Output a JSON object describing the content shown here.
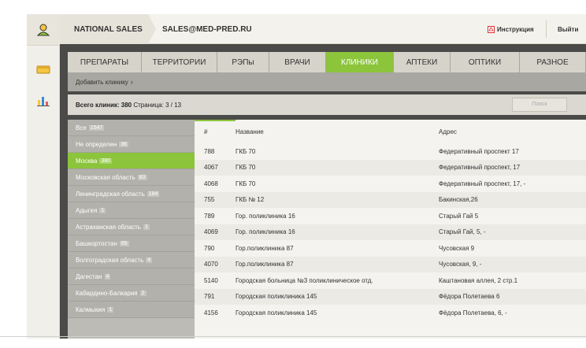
{
  "header": {
    "company": "NATIONAL SALES",
    "email": "SALES@MED-PRED.RU",
    "manual": "Инструкция",
    "logout": "Выйти"
  },
  "tabs": [
    {
      "label": "ПРЕПАРАТЫ",
      "active": false
    },
    {
      "label": "ТЕРРИТОРИИ",
      "active": false
    },
    {
      "label": "РЭПы",
      "active": false
    },
    {
      "label": "ВРАЧИ",
      "active": false
    },
    {
      "label": "КЛИНИКИ",
      "active": true
    },
    {
      "label": "АПТЕКИ",
      "active": false
    },
    {
      "label": "ОПТИКИ",
      "active": false
    },
    {
      "label": "РАЗНОЕ",
      "active": false
    }
  ],
  "add_clinic": "Добавить клинику",
  "info": {
    "total_label": "Всего клиник:",
    "total": "380",
    "page_label": "Страница:",
    "page": "3 / 13",
    "search_placeholder": "Поиск"
  },
  "regions": [
    {
      "name": "Все",
      "count": "1547",
      "active": false
    },
    {
      "name": "Не определен",
      "count": "36",
      "active": false
    },
    {
      "name": "Москва",
      "count": "380",
      "active": true
    },
    {
      "name": "Московская область",
      "count": "83",
      "active": false
    },
    {
      "name": "Ленинградская область",
      "count": "184",
      "active": false
    },
    {
      "name": "Адыгея",
      "count": "1",
      "active": false
    },
    {
      "name": "Астраханская область",
      "count": "1",
      "active": false
    },
    {
      "name": "Башкортостан",
      "count": "65",
      "active": false
    },
    {
      "name": "Волгоградская область",
      "count": "4",
      "active": false
    },
    {
      "name": "Дагестан",
      "count": "4",
      "active": false
    },
    {
      "name": "Кабардино-Балкария",
      "count": "2",
      "active": false
    },
    {
      "name": "Калмыкия",
      "count": "1",
      "active": false
    }
  ],
  "table": {
    "headers": {
      "id": "#",
      "name": "Название",
      "address": "Адрес"
    },
    "rows": [
      {
        "id": "788",
        "name": "ГКБ 70",
        "address": "Федеративный проспект 17"
      },
      {
        "id": "4067",
        "name": "ГКБ 70",
        "address": "Федеративный проспект, 17"
      },
      {
        "id": "4068",
        "name": "ГКБ 70",
        "address": "Федеративный проспект, 17, -"
      },
      {
        "id": "755",
        "name": "ГКБ № 12",
        "address": "Бакинская,26"
      },
      {
        "id": "789",
        "name": "Гор. поликлиника 16",
        "address": "Старый Гай 5"
      },
      {
        "id": "4069",
        "name": "Гор. поликлиника 16",
        "address": "Старый Гай, 5, -"
      },
      {
        "id": "790",
        "name": "Гор.поликлиника 87",
        "address": "Чусовская 9"
      },
      {
        "id": "4070",
        "name": "Гор.поликлиника 87",
        "address": "Чусовская, 9, -"
      },
      {
        "id": "5140",
        "name": "Городская больница №3 поликлиническое отд.",
        "address": "Каштановая аллея, 2 стр.1"
      },
      {
        "id": "791",
        "name": "Городская поликлиника 145",
        "address": "Фёдора Полетаева 6"
      },
      {
        "id": "4156",
        "name": "Городская поликлиника 145",
        "address": "Фёдора Полетаева, 6, -"
      }
    ]
  },
  "colors": {
    "accent": "#8cc43c",
    "panel": "#4a4a48"
  }
}
